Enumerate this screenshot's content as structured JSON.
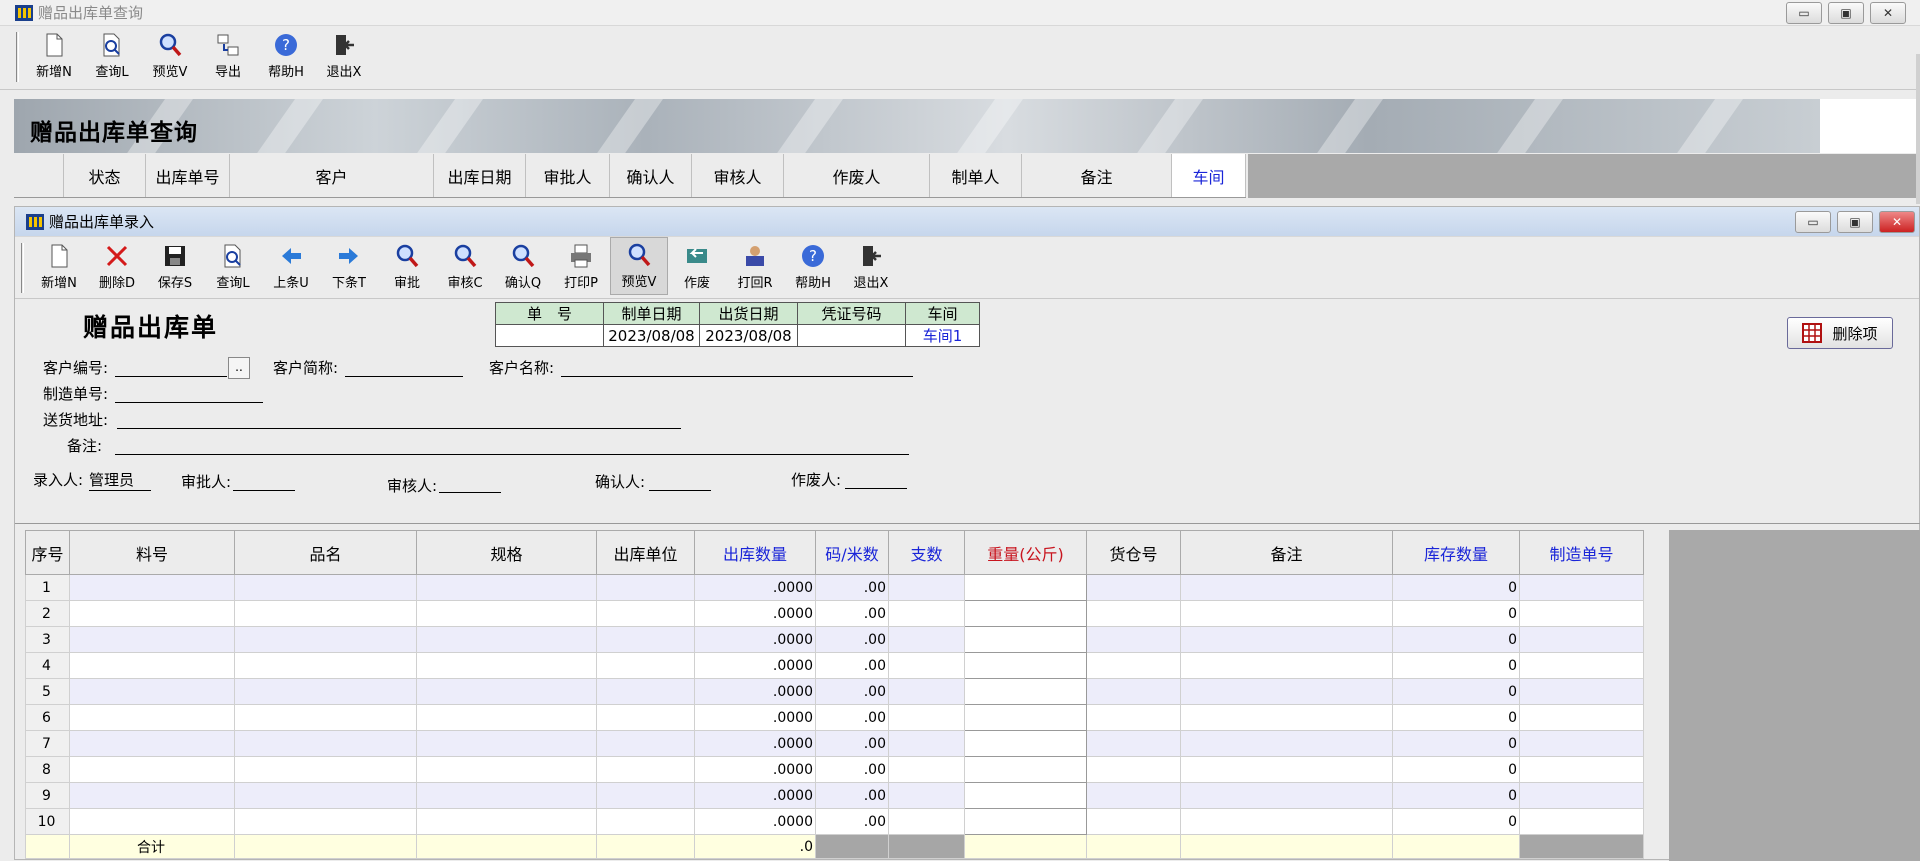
{
  "main_window": {
    "title": "赠品出库单查询",
    "toolbar": [
      "新增N",
      "查询L",
      "预览V",
      "导出",
      "帮助H",
      "退出X"
    ],
    "banner_title": "赠品出库单查询",
    "columns": [
      {
        "label": "",
        "w": 50
      },
      {
        "label": "状态",
        "w": 82
      },
      {
        "label": "出库单号",
        "w": 84
      },
      {
        "label": "客户",
        "w": 204
      },
      {
        "label": "出库日期",
        "w": 92
      },
      {
        "label": "审批人",
        "w": 84
      },
      {
        "label": "确认人",
        "w": 82
      },
      {
        "label": "审核人",
        "w": 92
      },
      {
        "label": "作废人",
        "w": 146
      },
      {
        "label": "制单人",
        "w": 92
      },
      {
        "label": "备注",
        "w": 150
      },
      {
        "label": "车间",
        "w": 74,
        "blue": true
      }
    ]
  },
  "child_window": {
    "title": "赠品出库单录入",
    "toolbar": [
      "新增N",
      "删除D",
      "保存S",
      "查询L",
      "上条U",
      "下条T",
      "审批",
      "审核C",
      "确认Q",
      "打印P",
      "预览V",
      "作废",
      "打回R",
      "帮助H",
      "退出X"
    ],
    "form_title": "赠品出库单",
    "header_table": {
      "labels": [
        "单　号",
        "制单日期",
        "出货日期",
        "凭证号码",
        "车间"
      ],
      "values": [
        "",
        "2023/08/08",
        "2023/08/08",
        "",
        "车间1"
      ]
    },
    "delete_item_button": "删除项",
    "fields": {
      "customer_no_label": "客户编号:",
      "customer_no": "",
      "browse_button": "..",
      "customer_short_label": "客户简称:",
      "customer_short": "",
      "customer_name_label": "客户名称:",
      "customer_name": "",
      "mfg_no_label": "制造单号:",
      "mfg_no": "",
      "address_label": "送货地址:",
      "address": "",
      "remark_label": "备注:",
      "remark": "",
      "entered_by_label": "录入人:",
      "entered_by": "管理员",
      "approver_label": "审批人:",
      "approver": "",
      "reviewer_label": "审核人:",
      "reviewer": "",
      "confirmer_label": "确认人:",
      "confirmer": "",
      "voider_label": "作废人:",
      "voider": ""
    },
    "grid": {
      "columns": [
        {
          "label": "序号",
          "w": 44
        },
        {
          "label": "料号",
          "w": 165
        },
        {
          "label": "品名",
          "w": 182
        },
        {
          "label": "规格",
          "w": 180
        },
        {
          "label": "出库单位",
          "w": 98
        },
        {
          "label": "出库数量",
          "w": 121,
          "color": "blue"
        },
        {
          "label": "码/米数",
          "w": 73,
          "color": "blue"
        },
        {
          "label": "支数",
          "w": 76,
          "color": "blue"
        },
        {
          "label": "重量(公斤)",
          "w": 122,
          "color": "red"
        },
        {
          "label": "货仓号",
          "w": 94
        },
        {
          "label": "备注",
          "w": 212
        },
        {
          "label": "库存数量",
          "w": 127,
          "color": "blue"
        },
        {
          "label": "制造单号",
          "w": 124,
          "color": "blue"
        }
      ],
      "rows": [
        {
          "seq": "1",
          "qty": ".0000",
          "yard": ".00",
          "stock": "0"
        },
        {
          "seq": "2",
          "qty": ".0000",
          "yard": ".00",
          "stock": "0"
        },
        {
          "seq": "3",
          "qty": ".0000",
          "yard": ".00",
          "stock": "0"
        },
        {
          "seq": "4",
          "qty": ".0000",
          "yard": ".00",
          "stock": "0"
        },
        {
          "seq": "5",
          "qty": ".0000",
          "yard": ".00",
          "stock": "0"
        },
        {
          "seq": "6",
          "qty": ".0000",
          "yard": ".00",
          "stock": "0"
        },
        {
          "seq": "7",
          "qty": ".0000",
          "yard": ".00",
          "stock": "0"
        },
        {
          "seq": "8",
          "qty": ".0000",
          "yard": ".00",
          "stock": "0"
        },
        {
          "seq": "9",
          "qty": ".0000",
          "yard": ".00",
          "stock": "0"
        },
        {
          "seq": "10",
          "qty": ".0000",
          "yard": ".00",
          "stock": "0"
        }
      ],
      "total_label": "合计",
      "total_qty": ".0"
    }
  }
}
